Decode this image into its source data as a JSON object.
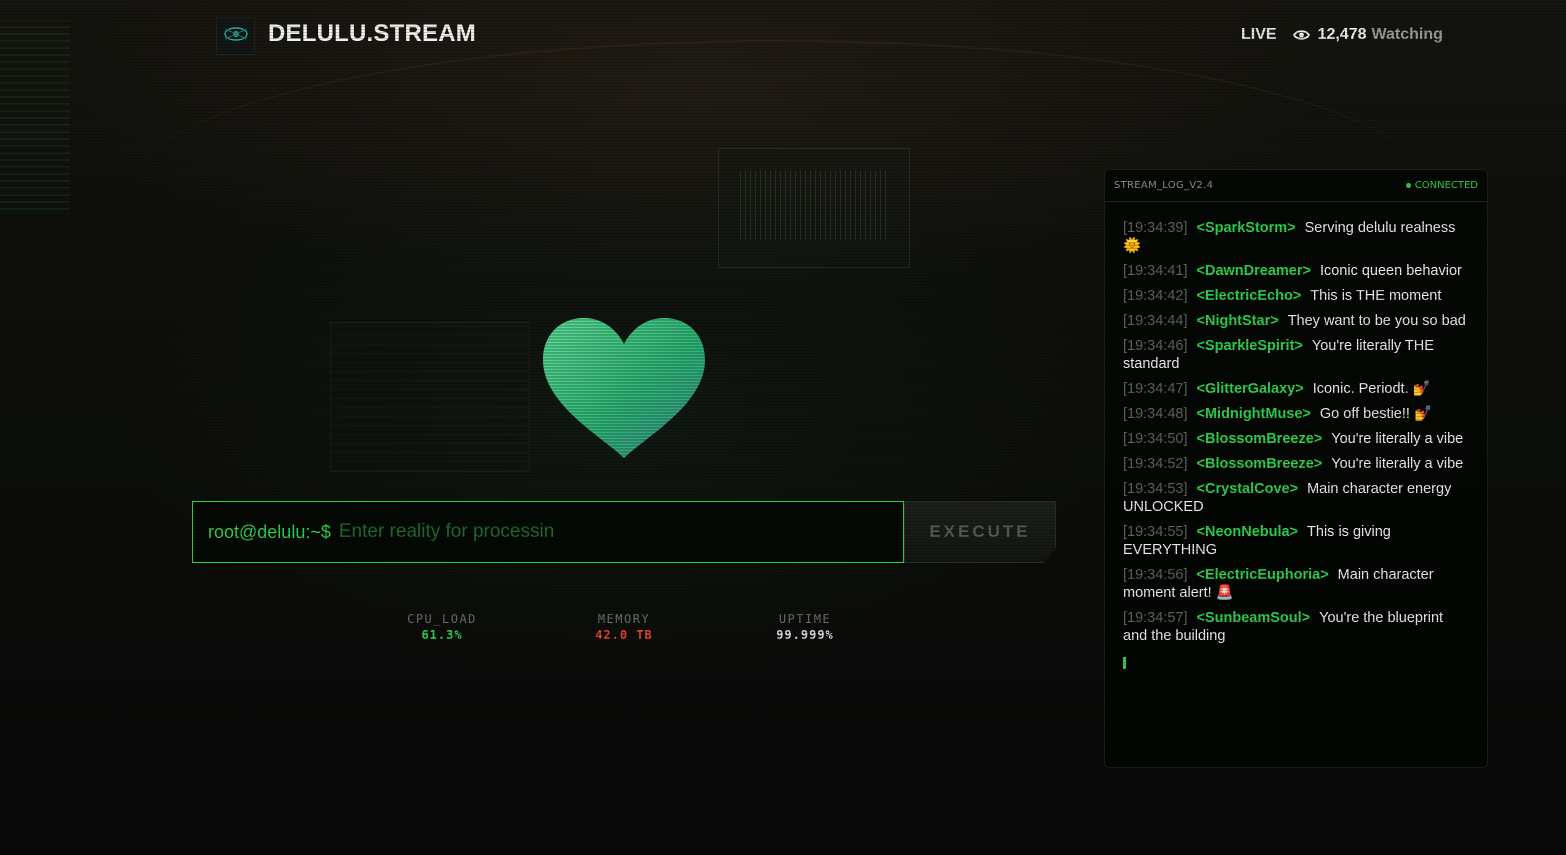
{
  "header": {
    "brand": "DELULU.STREAM",
    "logo_icon": "eye-glitch-icon",
    "live_label": "LIVE",
    "viewer_count": "12,478",
    "watching_label": "Watching"
  },
  "heart": {
    "icon": "heart-icon",
    "colors": [
      "#57d88a",
      "#2bb873",
      "#3a9a8a"
    ]
  },
  "command": {
    "prompt": "root@delulu:~$",
    "placeholder": "Enter reality for processin",
    "value": "",
    "execute_label": "EXECUTE"
  },
  "stats": [
    {
      "label": "CPU_LOAD",
      "value": "61.3%",
      "color": "#2fd14b"
    },
    {
      "label": "MEMORY",
      "value": "42.0 TB",
      "color": "#e0452a"
    },
    {
      "label": "UPTIME",
      "value": "99.999%",
      "color": "#d8d8d8"
    }
  ],
  "chat": {
    "title": "STREAM_LOG_V2.4",
    "status": "CONNECTED",
    "messages": [
      {
        "time": "[19:34:39]",
        "user": "<SparkStorm>",
        "text": "Serving delulu realness 🌞"
      },
      {
        "time": "[19:34:41]",
        "user": "<DawnDreamer>",
        "text": "Iconic queen behavior"
      },
      {
        "time": "[19:34:42]",
        "user": "<ElectricEcho>",
        "text": "This is THE moment"
      },
      {
        "time": "[19:34:44]",
        "user": "<NightStar>",
        "text": "They want to be you so bad"
      },
      {
        "time": "[19:34:46]",
        "user": "<SparkleSpirit>",
        "text": "You're literally THE standard"
      },
      {
        "time": "[19:34:47]",
        "user": "<GlitterGalaxy>",
        "text": "Iconic. Periodt. 💅"
      },
      {
        "time": "[19:34:48]",
        "user": "<MidnightMuse>",
        "text": "Go off bestie!! 💅"
      },
      {
        "time": "[19:34:50]",
        "user": "<BlossomBreeze>",
        "text": "You're literally a vibe"
      },
      {
        "time": "[19:34:52]",
        "user": "<BlossomBreeze>",
        "text": "You're literally a vibe"
      },
      {
        "time": "[19:34:53]",
        "user": "<CrystalCove>",
        "text": "Main character energy UNLOCKED"
      },
      {
        "time": "[19:34:55]",
        "user": "<NeonNebula>",
        "text": "This is giving EVERYTHING"
      },
      {
        "time": "[19:34:56]",
        "user": "<ElectricEuphoria>",
        "text": "Main character moment alert! 🚨"
      },
      {
        "time": "[19:34:57]",
        "user": "<SunbeamSoul>",
        "text": "You're the blueprint and the building"
      }
    ]
  }
}
